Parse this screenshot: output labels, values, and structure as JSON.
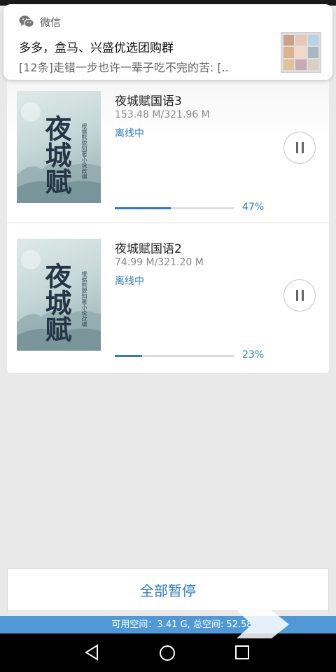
{
  "notification": {
    "app_name": "微信",
    "title": "多多，盒马、兴盛优选团购群",
    "message": "[12条]走错一步也许一辈子吃不完的苦: [.."
  },
  "downloads": [
    {
      "title": "夜城赋国语3",
      "size": "153.48 M/321.96 M",
      "status": "离线中",
      "progress": 47,
      "progress_text": "47%",
      "cover_title": "夜城赋",
      "cover_subtitle": "根据熊貌知著小说改编"
    },
    {
      "title": "夜城赋国语2",
      "size": "74.99 M/321.20 M",
      "status": "离线中",
      "progress": 23,
      "progress_text": "23%",
      "cover_title": "夜城赋",
      "cover_subtitle": "根据熊貌知著小说改编"
    }
  ],
  "pause_all_label": "全部暂停",
  "storage": {
    "text": "可用空间：3.41 G, 总空间: 52.58"
  },
  "colors": {
    "accent": "#2f7cc4",
    "storage_bar": "#7db6e2"
  },
  "icons": {
    "notification_app": "wechat-icon",
    "pause": "pause-icon",
    "nav_back": "back-triangle-icon",
    "nav_home": "home-circle-icon",
    "nav_recent": "recent-square-icon"
  }
}
